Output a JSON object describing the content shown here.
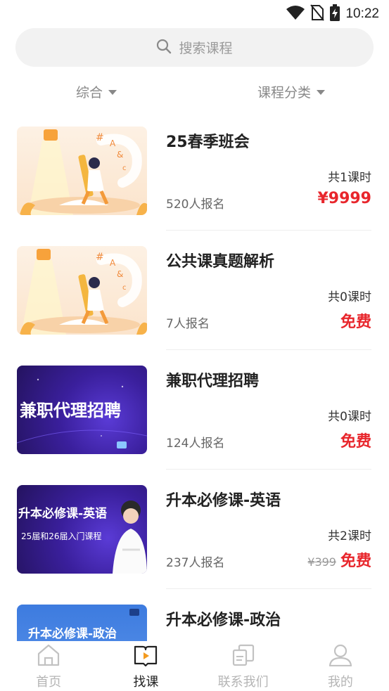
{
  "status_bar": {
    "time": "10:22",
    "icons": [
      "wifi-icon",
      "no-sim-icon",
      "battery-charging-icon"
    ]
  },
  "search": {
    "placeholder": "搜索课程",
    "icon": "search-icon"
  },
  "filters": {
    "sort_label": "综合",
    "category_label": "课程分类"
  },
  "courses": [
    {
      "title": "25春季班会",
      "lessons": "共1课时",
      "enrolled": "520人报名",
      "price": "¥9999",
      "thumb_style": "warm"
    },
    {
      "title": "公共课真题解析",
      "lessons": "共0课时",
      "enrolled": "7人报名",
      "price": "免费",
      "thumb_style": "warm"
    },
    {
      "title": "兼职代理招聘",
      "lessons": "共0课时",
      "enrolled": "124人报名",
      "price": "免费",
      "thumb_style": "purple",
      "thumb_text": "兼职代理招聘"
    },
    {
      "title": "升本必修课-英语",
      "lessons": "共2课时",
      "enrolled": "237人报名",
      "original_price": "¥399",
      "price": "免费",
      "thumb_style": "purple-teacher",
      "thumb_text": "升本必修课-英语",
      "thumb_subtext": "25届和26届入门课程"
    },
    {
      "title": "升本必修课-政治",
      "thumb_style": "blue",
      "thumb_text": "升本必修课-政治"
    }
  ],
  "tabbar": {
    "tabs": [
      {
        "label": "首页",
        "icon": "home-icon",
        "active": false
      },
      {
        "label": "找课",
        "icon": "find-course-icon",
        "active": true
      },
      {
        "label": "联系我们",
        "icon": "contact-icon",
        "active": false
      },
      {
        "label": "我的",
        "icon": "profile-icon",
        "active": false
      }
    ]
  },
  "colors": {
    "accent_red": "#e8262c",
    "search_bg": "#f2f2f2",
    "inactive_tab": "#b5b5b5"
  }
}
